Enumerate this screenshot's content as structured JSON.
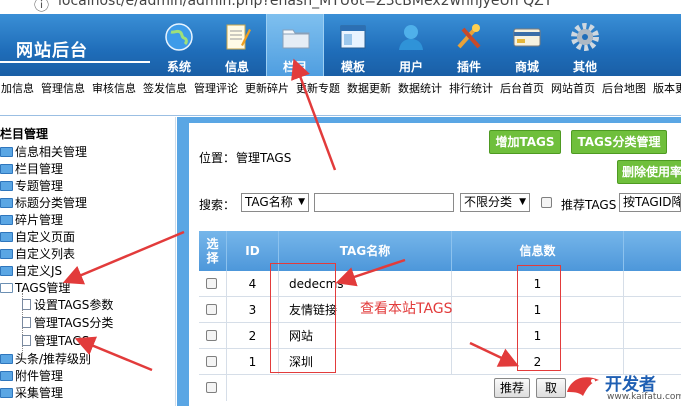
{
  "browser": {
    "url": "localhost/e/admin/admin.php?ehash_MYU6t=Z3cBMex2wnnjyeUn QZY"
  },
  "header": {
    "title": "网站后台",
    "nav": [
      {
        "label": "系统",
        "icon": "globe-icon"
      },
      {
        "label": "信息",
        "icon": "notepad-icon"
      },
      {
        "label": "栏目",
        "icon": "folder-icon",
        "active": true
      },
      {
        "label": "模板",
        "icon": "window-icon"
      },
      {
        "label": "用户",
        "icon": "user-icon"
      },
      {
        "label": "插件",
        "icon": "tools-icon"
      },
      {
        "label": "商城",
        "icon": "card-icon"
      },
      {
        "label": "其他",
        "icon": "gear-icon"
      }
    ]
  },
  "menu": [
    "增加信息",
    "管理信息",
    "审核信息",
    "签发信息",
    "管理评论",
    "更新碎片",
    "更新专题",
    "数据更新",
    "数据统计",
    "排行统计",
    "后台首页",
    "网站首页",
    "后台地图",
    "版本更新"
  ],
  "sidebar": {
    "heading": "栏目管理",
    "items": [
      "信息相关管理",
      "栏目管理",
      "专题管理",
      "标题分类管理",
      "碎片管理",
      "自定义页面",
      "自定义列表",
      "自定义JS",
      "TAGS管理"
    ],
    "sub_items": [
      "设置TAGS参数",
      "管理TAGS分类",
      "管理TAGS"
    ],
    "bottom_items": [
      "头条/推荐级别",
      "附件管理",
      "采集管理"
    ]
  },
  "main": {
    "location_label": "位置：",
    "location_link": "管理TAGS",
    "buttons": {
      "add_tags": "增加TAGS",
      "tags_category": "TAGS分类管理",
      "delete_unused": "删除使用率"
    },
    "search": {
      "label": "搜索：",
      "field_select": "TAG名称",
      "category_select": "不限分类",
      "recommend_label": "推荐TAGS",
      "sort_select": "按TAGID降"
    },
    "table": {
      "headers": [
        "选择",
        "ID",
        "TAG名称",
        "信息数"
      ],
      "rows": [
        {
          "id": "4",
          "name": "dedecms",
          "count": "1"
        },
        {
          "id": "3",
          "name": "友情链接",
          "count": "1"
        },
        {
          "id": "2",
          "name": "网站",
          "count": "1"
        },
        {
          "id": "1",
          "name": "深圳",
          "count": "2"
        }
      ],
      "recommend_button": "推荐",
      "next_button": "取"
    }
  },
  "annotation": {
    "text": "查看本站TAGS"
  },
  "watermark": {
    "name": "开发者",
    "site": "www.kaifatu.com"
  },
  "colors": {
    "header_blue": "#1f6db9",
    "frame_blue": "#5aa6e4",
    "button_green": "#6fbf3c",
    "annotation_red": "#e23b3b"
  }
}
